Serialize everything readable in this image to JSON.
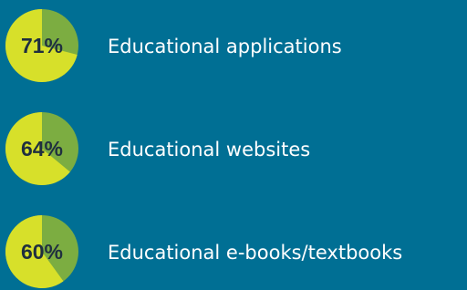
{
  "chart_data": {
    "type": "pie",
    "items": [
      {
        "label": "Educational applications",
        "value": 71,
        "value_label": "71%"
      },
      {
        "label": "Educational websites",
        "value": 64,
        "value_label": "64%"
      },
      {
        "label": "Educational e-books/textbooks",
        "value": 60,
        "value_label": "60%"
      }
    ]
  },
  "colors": {
    "background": "#006f94",
    "highlight": "#d7e02a",
    "remainder": "#7cad41",
    "value_text": "#1f2f3f",
    "label_text": "#ffffff"
  }
}
